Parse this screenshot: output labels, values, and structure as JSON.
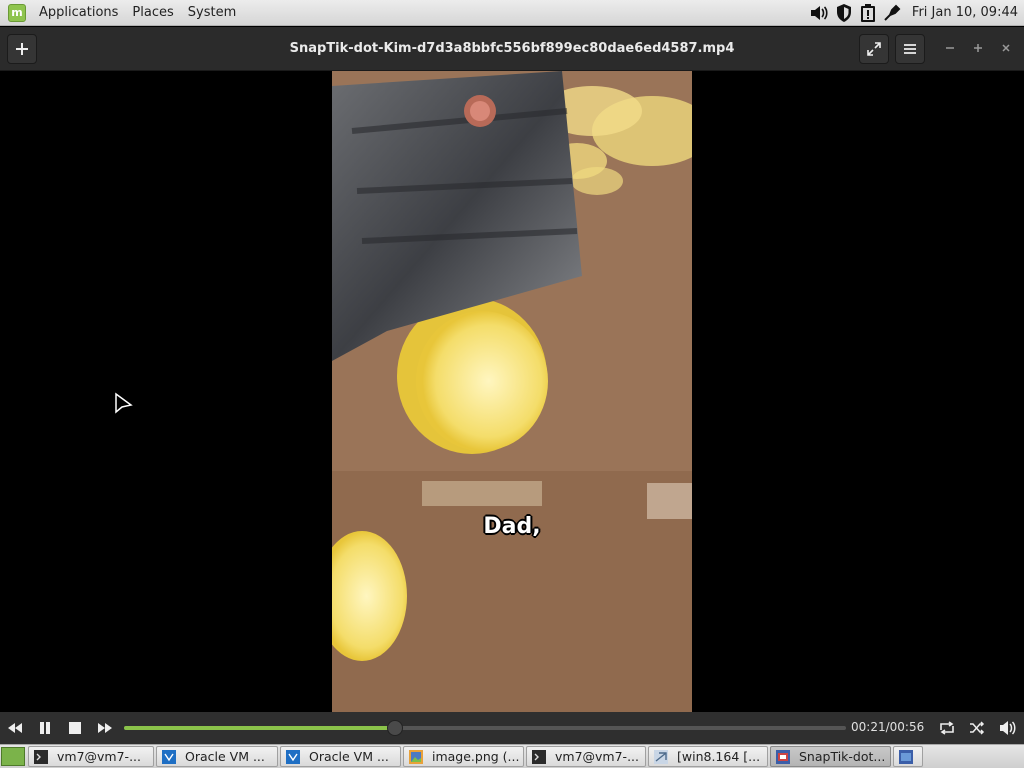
{
  "top_panel": {
    "menu": [
      "Applications",
      "Places",
      "System"
    ],
    "clock": "Fri Jan 10, 09:44"
  },
  "window": {
    "title": "SnapTik-dot-Kim-d7d3a8bbfc556bf899ec80dae6ed4587.mp4"
  },
  "video": {
    "subtitle": "Dad,"
  },
  "controls": {
    "time": "00:21/00:56",
    "progress": 0.375
  },
  "taskbar": {
    "tasks": [
      {
        "label": "vm7@vm7-...",
        "icon": "terminal-icon"
      },
      {
        "label": "Oracle VM ...",
        "icon": "virtualbox-icon"
      },
      {
        "label": "Oracle VM ...",
        "icon": "virtualbox-icon"
      },
      {
        "label": "image.png (...",
        "icon": "image-viewer-icon"
      },
      {
        "label": "vm7@vm7-...",
        "icon": "terminal-icon"
      },
      {
        "label": "[win8.164 [...",
        "icon": "remote-desktop-icon"
      },
      {
        "label": "SnapTik-dot...",
        "icon": "video-player-icon"
      }
    ]
  },
  "colors": {
    "accent": "#8bc34a",
    "titlebar": "#2b2b2b",
    "controls": "#2f2f2f"
  }
}
